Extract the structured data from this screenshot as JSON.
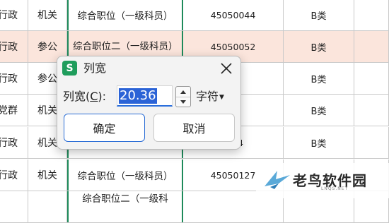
{
  "sheet": {
    "rows": [
      {
        "a": "行政",
        "b": "机关",
        "c": "综合职位（一级科员）",
        "d": "45050044",
        "e": "B类",
        "highlight": false
      },
      {
        "a": "行政",
        "b": "参公",
        "c": "综合职位二（一级科员）",
        "d": "45050052",
        "e": "B类",
        "highlight": true
      },
      {
        "a": "行政",
        "b": "参公",
        "c": "",
        "d": "",
        "e": "B类",
        "highlight": false
      },
      {
        "a": "党群",
        "b": "机关",
        "c": "",
        "d": "",
        "e": "B类",
        "highlight": false
      },
      {
        "a": "行政",
        "b": "机关",
        "c": "",
        "d": "4",
        "e": "B类",
        "highlight": false
      },
      {
        "a": "行政",
        "b": "机关",
        "c": "综合职位（一级科员）",
        "d": "45050127",
        "e": "",
        "highlight": false
      },
      {
        "a": "",
        "b": "",
        "c": "综合职位二（一级科",
        "d": "",
        "e": "",
        "highlight": false
      }
    ]
  },
  "dialog": {
    "app_icon": "S",
    "title": "列宽",
    "label_prefix": "列宽(",
    "label_hotkey": "C",
    "label_suffix": "):",
    "value": "20.36",
    "unit": "字符",
    "ok_label": "确定",
    "cancel_label": "取消"
  },
  "watermark": {
    "name": "老鸟软件园",
    "sub": "LNQS.NET"
  },
  "colors": {
    "accent": "#2b63d6",
    "selected_column_border": "#1e8a5a",
    "highlight_row": "#fbe5dc",
    "app_icon": "#1f9d5c"
  }
}
